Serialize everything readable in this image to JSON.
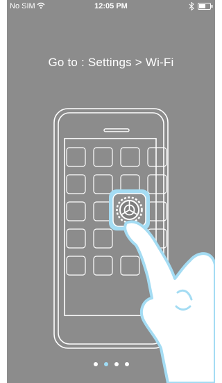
{
  "status_bar": {
    "carrier": "No SIM",
    "time": "12:05 PM",
    "icons": [
      "wifi-icon",
      "bluetooth-icon",
      "battery-icon"
    ]
  },
  "onboarding": {
    "title": "Go to : Settings > Wi-Fi",
    "page_indicator": {
      "total": 4,
      "current": 2
    }
  },
  "illustration": {
    "device": "phone-outline",
    "highlighted_app": "settings-gear-icon",
    "gesture": "tap-hand-icon"
  },
  "colors": {
    "background": "#8c8c8c",
    "foreground": "#ffffff",
    "accent": "#9fdcf5"
  }
}
